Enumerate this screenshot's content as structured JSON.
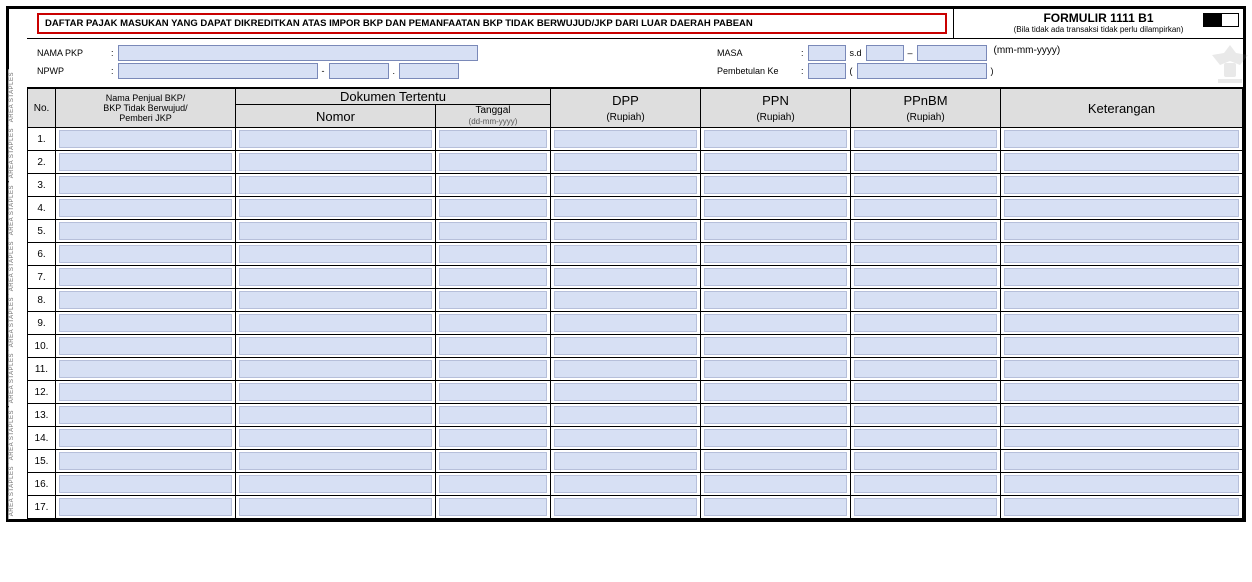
{
  "staple_label": "AREA STAPLES",
  "staple_count": 8,
  "header": {
    "title": "DAFTAR PAJAK MASUKAN YANG DAPAT DIKREDITKAN ATAS IMPOR BKP DAN PEMANFAATAN BKP TIDAK BERWUJUD/JKP DARI LUAR DAERAH PABEAN",
    "form_code": "FORMULIR 1111 B1",
    "form_sub": "(Bila tidak ada transaksi tidak perlu dilampirkan)",
    "checks": [
      true,
      false
    ]
  },
  "identity": {
    "nama_label": "NAMA PKP",
    "npwp_label": "NPWP",
    "nama_value": "",
    "npwp_segments": [
      "",
      "",
      ""
    ],
    "masa_label": "MASA",
    "sd_label": "s.d",
    "dash": "–",
    "masa_from": "",
    "masa_to": "",
    "masa_year": "",
    "date_hint": "(mm-mm-yyyy)",
    "pembetulan_label": "Pembetulan Ke",
    "pembetulan_no": "",
    "pembetulan_word": "",
    "colon": ":"
  },
  "table": {
    "headers": {
      "no": "No.",
      "nama": "Nama Penjual BKP/\nBKP Tidak Berwujud/\nPemberi JKP",
      "dokumen": "Dokumen Tertentu",
      "nomor": "Nomor",
      "tanggal": "Tanggal",
      "tanggal_sub": "(dd-mm-yyyy)",
      "dpp": "DPP",
      "ppn": "PPN",
      "ppnbm": "PPnBM",
      "rupiah": "(Rupiah)",
      "keterangan": "Keterangan"
    },
    "rows": [
      {
        "n": "1."
      },
      {
        "n": "2."
      },
      {
        "n": "3."
      },
      {
        "n": "4."
      },
      {
        "n": "5."
      },
      {
        "n": "6."
      },
      {
        "n": "7."
      },
      {
        "n": "8."
      },
      {
        "n": "9."
      },
      {
        "n": "10."
      },
      {
        "n": "11."
      },
      {
        "n": "12."
      },
      {
        "n": "13."
      },
      {
        "n": "14."
      },
      {
        "n": "15."
      },
      {
        "n": "16."
      },
      {
        "n": "17."
      }
    ]
  }
}
